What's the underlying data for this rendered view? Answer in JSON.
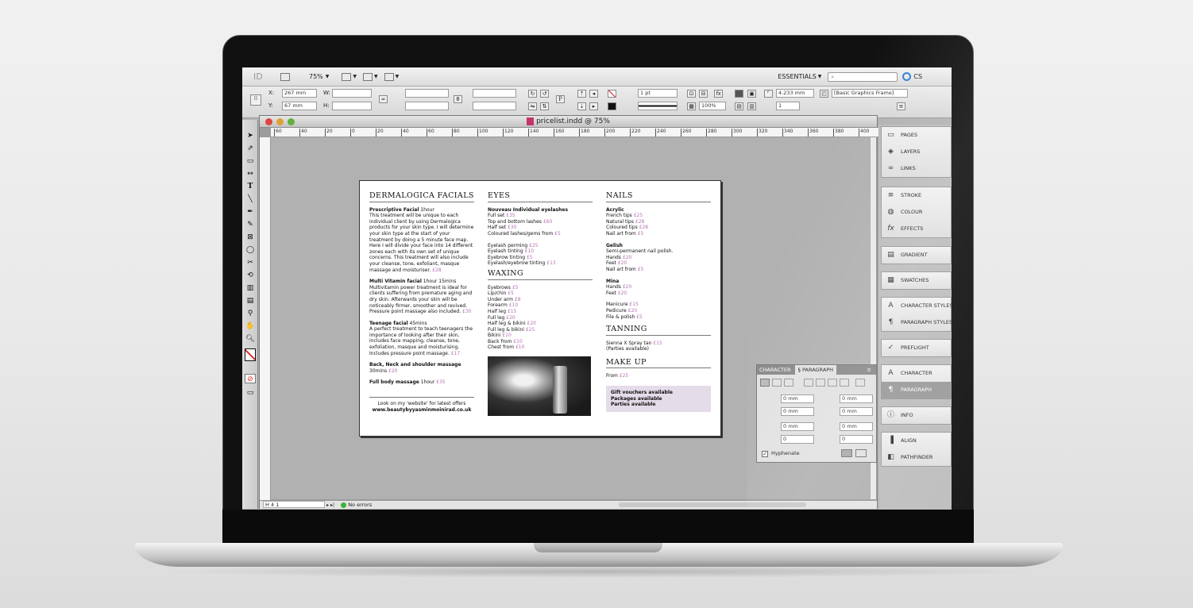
{
  "app": {
    "logo": "ID",
    "zoom": "75%",
    "workspace": "ESSENTIALS",
    "search_placeholder": "",
    "cs_label": "CS"
  },
  "control_bar": {
    "x_label": "X:",
    "x_value": "267 mm",
    "y_label": "Y:",
    "y_value": "67 mm",
    "w_label": "W:",
    "h_label": "H:",
    "stroke_weight": "1 pt",
    "scale_value": "100%",
    "measure_value": "4.233 mm",
    "frame_style": "[Basic Graphics Frame]",
    "angle_value": "1"
  },
  "document": {
    "title": "pricelist.indd @ 75%",
    "ruler_ticks": [
      "60",
      "40",
      "20",
      "0",
      "20",
      "40",
      "60",
      "80",
      "100",
      "120",
      "140",
      "160",
      "180",
      "200",
      "220",
      "240",
      "260",
      "280",
      "300",
      "320",
      "340",
      "360",
      "380",
      "400"
    ],
    "status_page": "H 4 1",
    "status_errors": "No errors"
  },
  "pricelist": {
    "col1": {
      "heading": "DERMALOGICA FACIALS",
      "items": [
        {
          "title": "Prescriptive Facial",
          "duration": "1hour",
          "desc": "This treatment will be unique to each individual client by using Dermalogica products for your skin type. I will determine your skin type at the start of your treatment by doing a 5 minute face map. Here I will divide your face into 14 different zones each with its own set of unique concerns. This treatment will also include your cleanse, tone, exfoliant, masque massage and moisturiser.",
          "price": "£28"
        },
        {
          "title": "Multi Vitamin facial",
          "duration": "1hour 15mins",
          "desc": "Multivitamin power treatment is ideal for clients suffering from premature aging and dry skin. Afterwards your skin will be noticeably firmer, smoother and revived. Pressure point massage also included.",
          "price": "£30"
        },
        {
          "title": "Teenage facial",
          "duration": "45mins",
          "desc": "A perfect treatment to teach teenagers the importance of looking after their skin, includes face mapping, cleanse, tone, exfoliation, masque and moisturising. Includes pressure point massage.",
          "price": "£17"
        },
        {
          "title": "Back, Neck and shoulder massage",
          "duration": "30mins",
          "desc": "",
          "price": "£20"
        },
        {
          "title": "Full body massage",
          "duration": "1hour",
          "desc": "",
          "price": "£35"
        }
      ],
      "footer_line1": "Look on my 'website' for latest offers",
      "footer_line2": "www.beautybyyasminmoinirad.co.uk"
    },
    "col2": {
      "heading_eyes": "EYES",
      "eyes_title": "Nouveau Individual eyelashes",
      "eyes_items": [
        {
          "name": "Full set",
          "price": "£35"
        },
        {
          "name": "Top and bottom lashes",
          "price": "£60"
        },
        {
          "name": "Half set",
          "price": "£30"
        },
        {
          "name": "Coloured lashes/gems from",
          "price": "£5"
        }
      ],
      "eyes_items2": [
        {
          "name": "Eyelash perming",
          "price": "£25"
        },
        {
          "name": "Eyelash tinting",
          "price": "£10"
        },
        {
          "name": "Eyebrow tinting",
          "price": "£5"
        },
        {
          "name": "Eyelash/eyebrow tinting",
          "price": "£13"
        }
      ],
      "heading_waxing": "WAXING",
      "waxing_items": [
        {
          "name": "Eyebrows",
          "price": "£5"
        },
        {
          "name": "Lip/chin",
          "price": "£5"
        },
        {
          "name": "Under arm",
          "price": "£8"
        },
        {
          "name": "Forearm",
          "price": "£10"
        },
        {
          "name": "Half leg",
          "price": "£15"
        },
        {
          "name": "Full leg",
          "price": "£20"
        },
        {
          "name": "Half leg & bikini",
          "price": "£20"
        },
        {
          "name": "Full leg & bikini",
          "price": "£25"
        },
        {
          "name": "Bikini",
          "price": "£10"
        },
        {
          "name": "Back from",
          "price": "£10"
        },
        {
          "name": "Chest from",
          "price": "£10"
        }
      ]
    },
    "col3": {
      "heading_nails": "NAILS",
      "acrylic_title": "Acrylic",
      "acrylic_items": [
        {
          "name": "French tips",
          "price": "£25"
        },
        {
          "name": "Natural tips",
          "price": "£28"
        },
        {
          "name": "Coloured tips",
          "price": "£28"
        },
        {
          "name": "Nail art from",
          "price": "£5"
        }
      ],
      "gelish_title": "Gelish",
      "gelish_items": [
        {
          "name": "Semi-permanent nail polish.",
          "price": ""
        },
        {
          "name": "Hands",
          "price": "£20"
        },
        {
          "name": "Feet",
          "price": "£20"
        },
        {
          "name": "Nail art from",
          "price": "£5"
        }
      ],
      "mina_title": "Mina",
      "mina_items": [
        {
          "name": "Hands",
          "price": "£20"
        },
        {
          "name": "Feet",
          "price": "£20"
        }
      ],
      "other_items": [
        {
          "name": "Manicure",
          "price": "£15"
        },
        {
          "name": "Pedicure",
          "price": "£20"
        },
        {
          "name": "File & polish",
          "price": "£5"
        }
      ],
      "heading_tanning": "TANNING",
      "tan_line": "Sienna X Spray tan",
      "tan_price": "£15",
      "tan_note": "(Parties available)",
      "heading_makeup": "MAKE UP",
      "makeup_line": "From",
      "makeup_price": "£25",
      "gift_lines": [
        "Gift vouchers available",
        "Packages available",
        "Parties available"
      ]
    }
  },
  "panels": {
    "group1": [
      "PAGES",
      "LAYERS",
      "LINKS"
    ],
    "group2": [
      "STROKE",
      "COLOUR",
      "EFFECTS"
    ],
    "group3": [
      "GRADIENT"
    ],
    "group4": [
      "SWATCHES"
    ],
    "group5": [
      "CHARACTER STYLES",
      "PARAGRAPH STYLES"
    ],
    "group6": [
      "PREFLIGHT"
    ],
    "group7": [
      "CHARACTER",
      "PARAGRAPH"
    ],
    "group8": [
      "INFO"
    ],
    "group9": [
      "ALIGN",
      "PATHFINDER"
    ]
  },
  "paragraph_panel": {
    "tab_character": "CHARACTER",
    "tab_paragraph": "§ PARAGRAPH",
    "fields": [
      "0 mm",
      "0 mm",
      "0 mm",
      "0 mm",
      "0 mm",
      "0 mm",
      "0",
      "0"
    ],
    "hyphenate": "Hyphenate"
  }
}
